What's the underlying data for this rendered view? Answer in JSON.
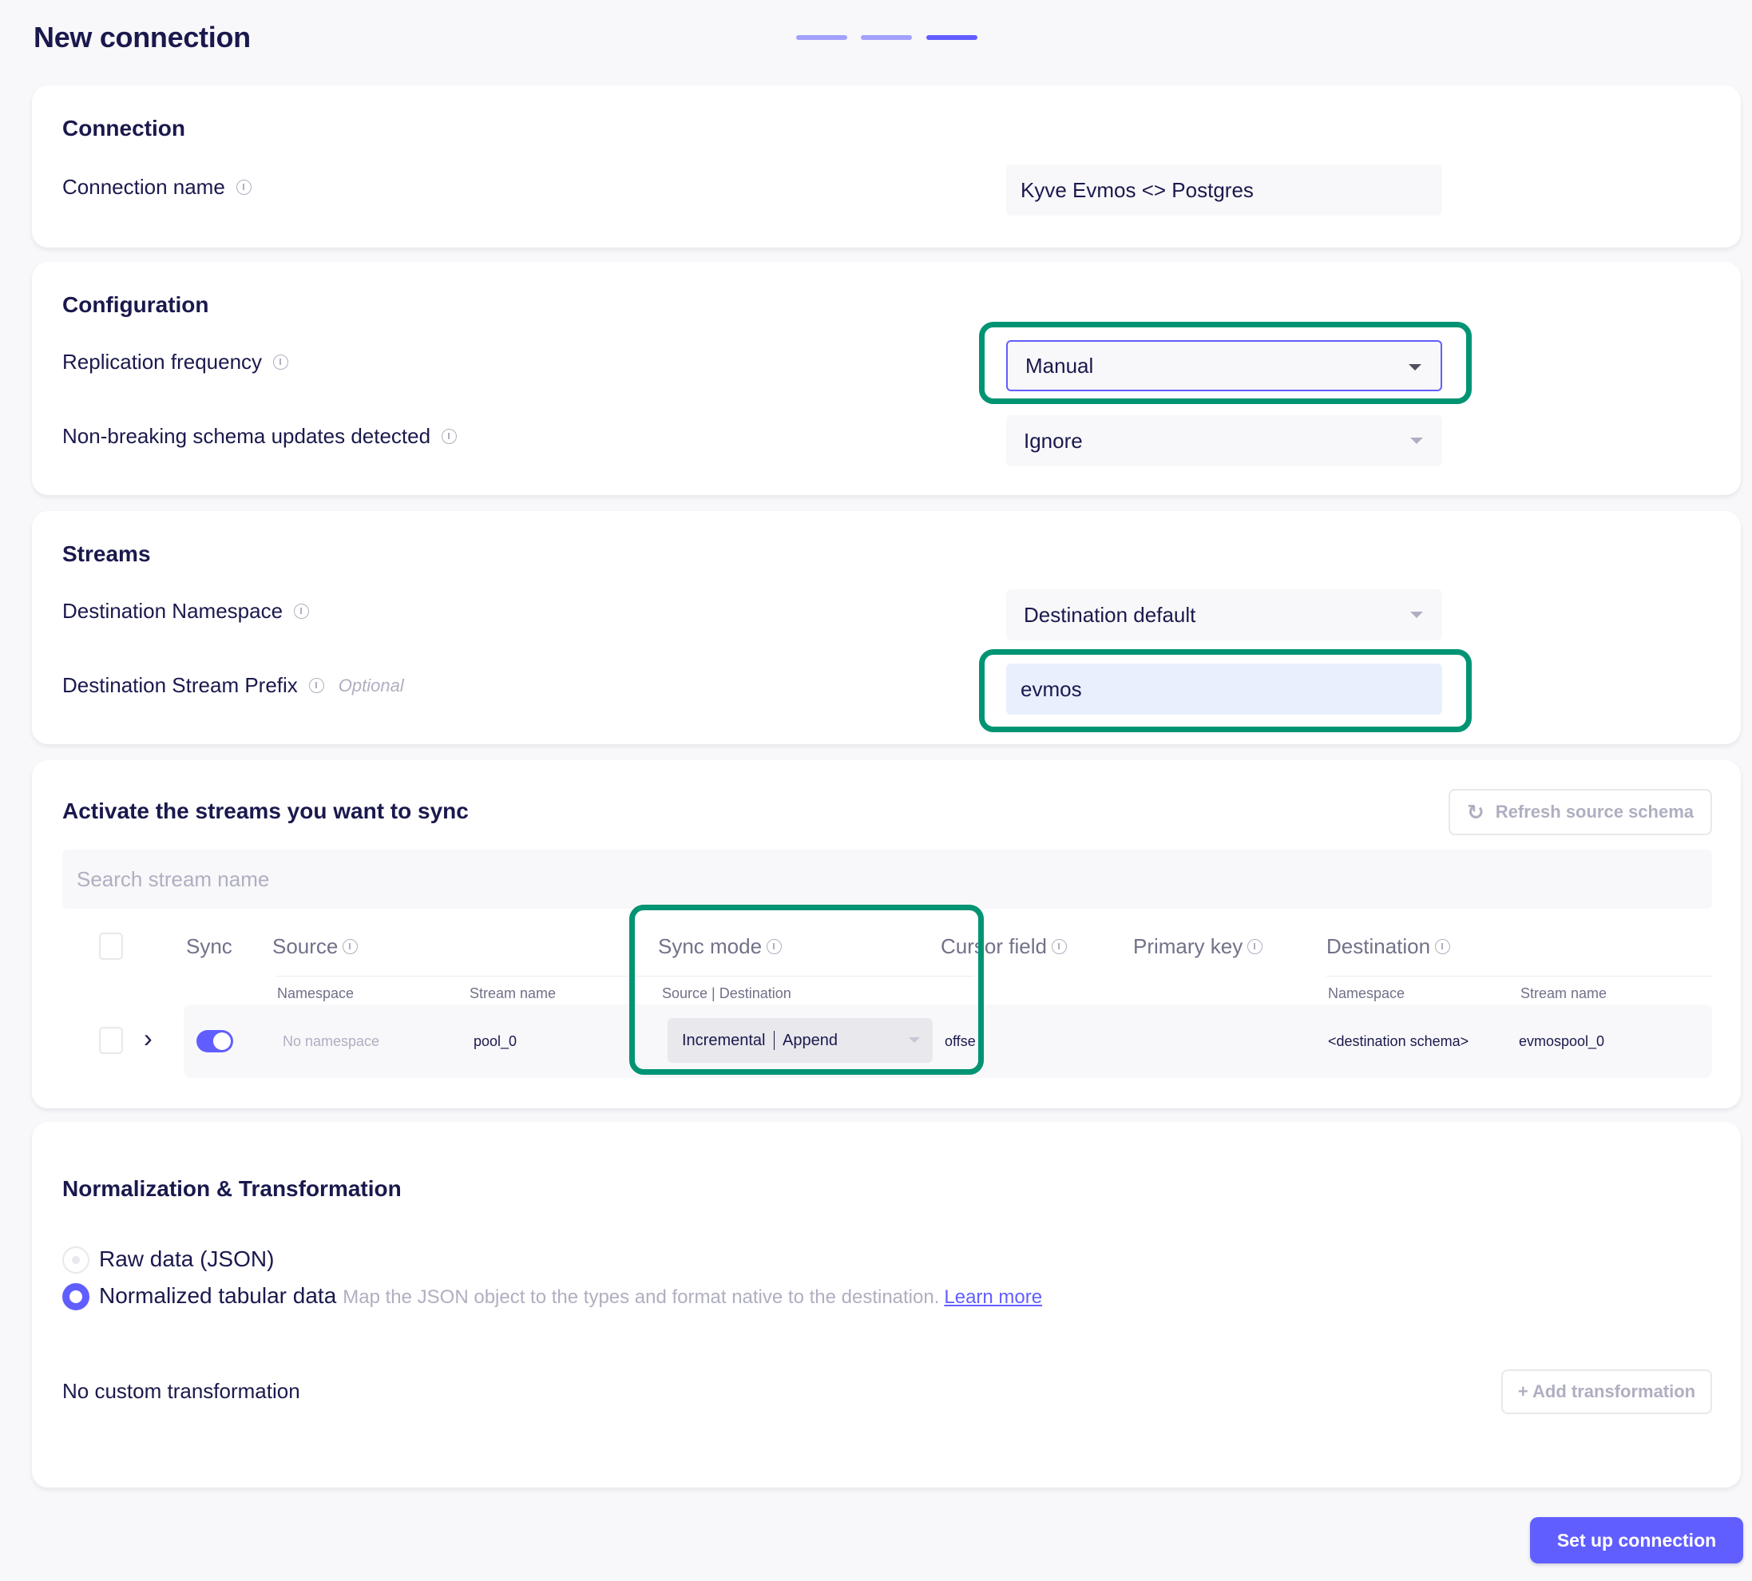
{
  "page": {
    "title": "New connection",
    "steps": [
      {
        "state": "completed",
        "color": "#a3a1ff"
      },
      {
        "state": "completed",
        "color": "#a3a1ff"
      },
      {
        "state": "current",
        "color": "#615eff"
      }
    ]
  },
  "connection": {
    "title": "Connection",
    "name_label": "Connection name",
    "name_value": "Kyve Evmos <> Postgres"
  },
  "configuration": {
    "title": "Configuration",
    "replication_label": "Replication frequency",
    "replication_value": "Manual",
    "schema_updates_label": "Non-breaking schema updates detected",
    "schema_updates_value": "Ignore"
  },
  "streams": {
    "title": "Streams",
    "namespace_label": "Destination Namespace",
    "namespace_value": "Destination default",
    "prefix_label": "Destination Stream Prefix",
    "prefix_optional": "Optional",
    "prefix_value": "evmos"
  },
  "activate": {
    "title": "Activate the streams you want to sync",
    "refresh_label": "Refresh source schema",
    "search_placeholder": "Search stream name",
    "columns": {
      "sync": "Sync",
      "source": "Source",
      "sync_mode": "Sync mode",
      "cursor_field": "Cursor field",
      "primary_key": "Primary key",
      "destination": "Destination"
    },
    "subcolumns": {
      "source_namespace": "Namespace",
      "source_stream_name": "Stream name",
      "sync_mode_sub": "Source | Destination",
      "dest_namespace": "Namespace",
      "dest_stream_name": "Stream name"
    },
    "rows": [
      {
        "selected": false,
        "sync_enabled": true,
        "namespace": "No namespace",
        "stream_name": "pool_0",
        "sync_mode_source": "Incremental",
        "sync_mode_destination": "Append",
        "cursor_field": "offse",
        "primary_key": "",
        "dest_namespace": "<destination schema>",
        "dest_stream_name": "evmospool_0"
      }
    ]
  },
  "normalization": {
    "title": "Normalization & Transformation",
    "options": [
      {
        "label": "Raw data (JSON)",
        "selected": false,
        "disabled": true
      },
      {
        "label": "Normalized tabular data",
        "selected": true,
        "description": "Map the JSON object to the types and format native to the destination.",
        "link": "Learn more"
      }
    ],
    "custom_transformation_text": "No custom transformation",
    "add_transformation_label": "+ Add transformation"
  },
  "footer": {
    "submit_label": "Set up connection"
  },
  "highlight_color": "#009473"
}
